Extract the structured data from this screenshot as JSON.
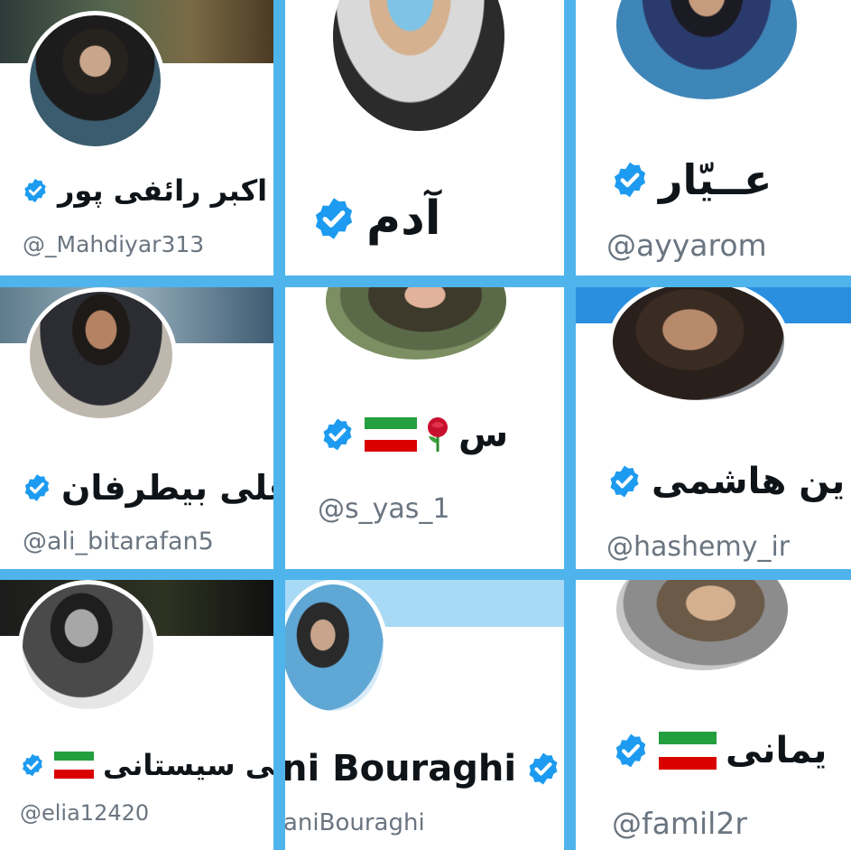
{
  "profiles": [
    {
      "name": "اکبر رائفی پور",
      "handle": "@_Mahdiyar313"
    },
    {
      "name": "آدم",
      "handle": ""
    },
    {
      "name": "عــیّار",
      "handle": "@ayyarom"
    },
    {
      "name": "علی بیطرفان",
      "handle": "@ali_bitarafan5"
    },
    {
      "name": "س",
      "handle": "@s_yas_1"
    },
    {
      "name": "ین هاشمی",
      "handle": "@hashemy_ir"
    },
    {
      "name": "لی سیستانی",
      "handle": "@elia12420"
    },
    {
      "name": "ni Bouraghi",
      "handle": "aniBouraghi"
    },
    {
      "name": "یمانی",
      "handle": "@famil2r"
    }
  ],
  "icons": {
    "verified": "verified-badge-icon",
    "flag": "iran-flag-icon",
    "rose": "rose-icon"
  },
  "colors": {
    "verified": "#1d9bf0",
    "grid_lines": "#4fb4ec",
    "flag_green": "#239f40",
    "flag_red": "#da0000"
  }
}
